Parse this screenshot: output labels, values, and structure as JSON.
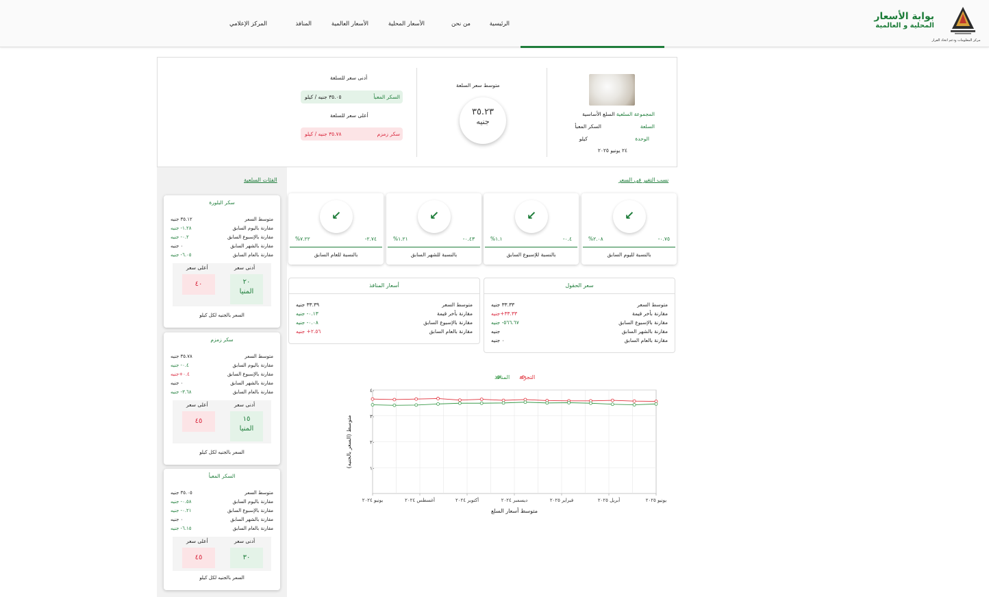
{
  "header": {
    "brand_line1": "بوابة الأسعار",
    "brand_line2": "المحلية و العالمية",
    "emblem_caption": "مركز المعلومات ودعم اتخاذ القرار",
    "nav": [
      {
        "label": "الرئيسية"
      },
      {
        "label": "من نحن"
      },
      {
        "label": "الأسعار المحلية"
      },
      {
        "label": "الأسعار العالمية"
      },
      {
        "label": "المنافذ"
      },
      {
        "label": "المركز الإعلامي"
      }
    ]
  },
  "summary": {
    "group_key": "المجموعة السلعية",
    "group_val": "السلع الأساسية",
    "commodity_key": "السلعة",
    "commodity_val": "السكر المعبأ",
    "unit_key": "الوحدة",
    "unit_val": "كيلو",
    "date": "٢٤ يونيو ٢٠٢٥",
    "avg_title": "متوسط سعر السلعة",
    "avg_value": "٣٥.٢٣",
    "avg_unit": "جنيه",
    "min_title": "أدنى سعر للسلعة",
    "min_name": "السكر المعبأ",
    "min_value": "٣٥.٠٥ جنيه / كيلو",
    "max_title": "أعلى سعر للسلعة",
    "max_name": "سكر زمزم",
    "max_value": "٣٥.٧٨ جنيه / كيلو"
  },
  "change": {
    "title": "نسب التغير في السعر",
    "cards": [
      {
        "abs": "٠.٧٥-",
        "pct": "٢.٠٨%",
        "label": "بالنسبة لليوم السابق",
        "icon": "arrow-down-left-icon"
      },
      {
        "abs": "٠.٤-",
        "pct": "١.١%",
        "label": "بالنسبة للإسبوع السابق",
        "icon": "arrow-down-left-icon"
      },
      {
        "abs": "٠.٤٣-",
        "pct": "١.٢١%",
        "label": "بالنسبة للشهر السابق",
        "icon": "arrow-down-left-icon"
      },
      {
        "abs": "٢.٧٤-",
        "pct": "٧.٢٢%",
        "label": "بالنسبة للعام السابق",
        "icon": "arrow-down-left-icon"
      }
    ]
  },
  "field_price": {
    "title": "سعر الحقول",
    "rows": [
      {
        "k": "متوسط السعر",
        "v": "٣٣.٣٣ جنيه",
        "c": "dark"
      },
      {
        "k": "مقارنة بأخر قيمة",
        "v": "٣٣.٣٣+جنيه",
        "c": "red"
      },
      {
        "k": "مقارنة بالإسبوع السابق",
        "v": "٥٦٦.٦٧- جنيه",
        "c": "green"
      },
      {
        "k": "مقارنة بالشهر السابق",
        "v": "جنيه",
        "c": "dark"
      },
      {
        "k": "مقارنة بالعام السابق",
        "v": "٠ جنيه",
        "c": "dark"
      }
    ]
  },
  "outlet_price": {
    "title": "أسعار المنافذ",
    "rows": [
      {
        "k": "متوسط السعر",
        "v": "٣٣.٣٩ جنيه",
        "c": "dark"
      },
      {
        "k": "مقارنة بأخر قيمة",
        "v": "٠.١٣- جنيه",
        "c": "green"
      },
      {
        "k": "مقارنة بالإسبوع السابق",
        "v": "٠.٠٨- جنيه",
        "c": "green"
      },
      {
        "k": "مقارنة بالعام السابق",
        "v": "٢.٥٦+ جنيه",
        "c": "red"
      }
    ]
  },
  "categories": {
    "title": "الفئات السلعية",
    "min_label": "أدنى سعر",
    "max_label": "أعلى سعر",
    "footer": "السعر بالجنيه لكل كيلو",
    "row_keys": [
      "متوسط السعر",
      "مقارنة باليوم السابق",
      "مقارنة بالإسبوع السابق",
      "مقارنة بالشهر السابق",
      "مقارنة بالعام السابق"
    ],
    "items": [
      {
        "name": "سكر البلورة",
        "vals": [
          "٣٥.١٢ جنيه",
          "١.٢٨- جنيه",
          "٠.٢- جنيه",
          "٠ جنيه",
          "٦.٠٥- جنيه"
        ],
        "colors": [
          "dark",
          "green",
          "green",
          "dark",
          "green"
        ],
        "min": "٢٠",
        "min_place": "المنيا",
        "max": "٤٠"
      },
      {
        "name": "سكر زمزم",
        "vals": [
          "٣٥.٧٨ جنيه",
          "٠.٤- جنيه",
          "٠.٤+جنيه",
          "٠ جنيه",
          "٣.٦٨- جنيه"
        ],
        "colors": [
          "dark",
          "green",
          "red",
          "dark",
          "green"
        ],
        "min": "١٥",
        "min_place": "المنيا",
        "max": "٤٥"
      },
      {
        "name": "السكر المعبأ",
        "vals": [
          "٣٥.٠٥ جنيه",
          "٠.٥٨- جنيه",
          "٠.٢١- جنيه",
          "٠ جنيه",
          "٦.١٥- جنيه"
        ],
        "colors": [
          "dark",
          "green",
          "green",
          "dark",
          "green"
        ],
        "min": "٣٠",
        "min_place": "",
        "max": "٤٥"
      }
    ]
  },
  "colors": {
    "accent": "#1e7d3a",
    "danger": "#d9263c"
  },
  "chart_data": {
    "type": "line",
    "title": "",
    "xlabel": "متوسط أسعار السلع",
    "ylabel": "متوسط (السعر بالجنيه)",
    "legend": [
      "التجزئة",
      "المنافذ"
    ],
    "legend_position": "top",
    "ylim": [
      0,
      40
    ],
    "yticks": [
      10,
      20,
      30,
      40
    ],
    "x_tick_labels": [
      "يونيو ٢٠٢٤",
      "أغسطس ٢٠٢٤",
      "أكتوبر ٢٠٢٤",
      "ديسمبر ٢٠٢٤",
      "فبراير ٢٠٢٥",
      "أبريل ٢٠٢٥",
      "يونيو ٢٠٢٥"
    ],
    "grid": true,
    "series": [
      {
        "name": "التجزئة",
        "color": "#e0303a",
        "values": [
          36.5,
          36.3,
          36.5,
          36.7,
          36.1,
          36.4,
          36.0,
          36.3,
          35.9,
          35.8,
          35.8,
          36.0,
          35.7,
          35.6
        ]
      },
      {
        "name": "المنافذ",
        "color": "#3a9a4a",
        "values": [
          34.3,
          34.1,
          34.2,
          34.6,
          34.9,
          34.9,
          35.0,
          35.3,
          35.0,
          35.1,
          34.9,
          34.5,
          34.3,
          34.6
        ]
      }
    ]
  }
}
